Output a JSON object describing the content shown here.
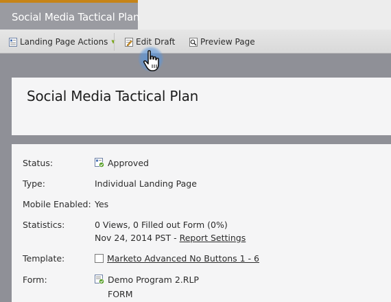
{
  "tab": {
    "title": "Social Media Tactical Plan"
  },
  "toolbar": {
    "landing_page_actions": "Landing Page Actions",
    "edit_draft": "Edit Draft",
    "preview_page": "Preview Page"
  },
  "page": {
    "title": "Social Media Tactical Plan"
  },
  "details": {
    "status": {
      "label": "Status:",
      "value": "Approved"
    },
    "type": {
      "label": "Type:",
      "value": "Individual Landing Page"
    },
    "mobile": {
      "label": "Mobile Enabled:",
      "value": "Yes"
    },
    "statistics": {
      "label": "Statistics:",
      "line1": "0 Views, 0 Filled out Form (0%)",
      "line2_prefix": "Nov 24, 2014 PST - ",
      "report_settings": "Report Settings"
    },
    "template": {
      "label": "Template:",
      "value": "Marketo Advanced No Buttons 1 - 6"
    },
    "form": {
      "label": "Form:",
      "line1": "Demo Program 2.RLP",
      "line2": "FORM"
    }
  },
  "colors": {
    "tab_accent": "#c68418",
    "background": "#8f9097",
    "panel": "#f5f5f6"
  }
}
